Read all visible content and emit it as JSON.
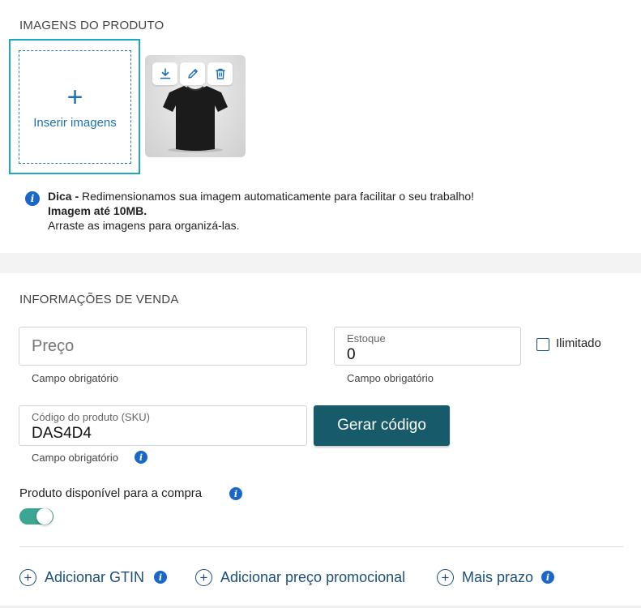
{
  "images": {
    "section_title": "IMAGENS DO PRODUTO",
    "upload_label": "Inserir imagens",
    "upload_plus": "+",
    "thumb_actions": [
      "download-icon",
      "pencil-icon",
      "trash-icon"
    ],
    "tip_icon": "i",
    "tip_bold": "Dica -",
    "tip_text": " Redimensionamos sua imagem automaticamente para facilitar o seu trabalho!",
    "tip_limit": "Imagem até 10MB.",
    "tip_drag": "Arraste as imagens para organizá-las."
  },
  "sales": {
    "section_title": "INFORMAÇÕES DE VENDA",
    "price_placeholder": "Preço",
    "price_helper": "Campo obrigatório",
    "stock_label": "Estoque",
    "stock_value": "0",
    "stock_helper": "Campo obrigatório",
    "unlimited_label": "Ilimitado",
    "unlimited_checked": false,
    "sku_label": "Código do produto (SKU)",
    "sku_value": "DAS4D4",
    "sku_helper": "Campo obrigatório",
    "generate_button": "Gerar código",
    "available_label": "Produto disponível para a compra",
    "available_on": true,
    "info_glyph": "i"
  },
  "actions": {
    "add_gtin": "Adicionar GTIN",
    "add_promo": "Adicionar preço promocional",
    "more_term": "Mais prazo",
    "plus_glyph": "+"
  },
  "colors": {
    "accent_border": "#1fa6c6",
    "link": "#1c4f7a",
    "primary_button": "#175b6b",
    "toggle_on": "#3aa693",
    "info_icon": "#1a66c9"
  }
}
